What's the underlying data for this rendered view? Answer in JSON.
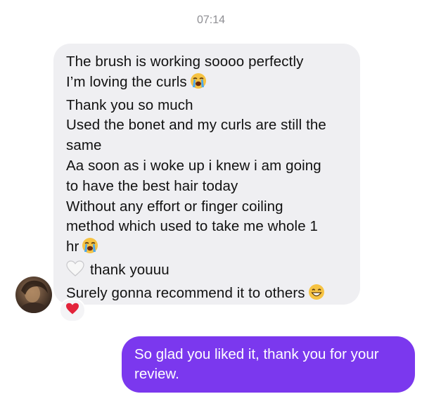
{
  "thread": {
    "timestamp": "07:14"
  },
  "incoming": {
    "lines": [
      "The brush is working soooo perfectly",
      "I’m loving the curls",
      "Thank you so much",
      "Used the bonet and my curls are still the",
      "same",
      "Aa soon as i woke up i knew i am going",
      "to have the best hair today",
      "Without any effort or finger coiling",
      "method which used to take me whole 1",
      "hr",
      "thank youuu",
      "Surely gonna recommend it to others"
    ],
    "emojis": {
      "line_2": "loudly-crying-face-emoji",
      "line_10": "loudly-crying-face-emoji",
      "line_11_lead": "white-heart-emoji",
      "line_12": "grinning-face-emoji"
    },
    "reaction": "red-heart-emoji"
  },
  "outgoing": {
    "lines": [
      "So glad you liked it, thank you for your",
      "review."
    ]
  },
  "colors": {
    "incoming_bubble": "#efeff2",
    "outgoing_bubble": "#7b38ee",
    "timestamp": "#8e8e93",
    "text": "#111111",
    "outgoing_text": "#ffffff"
  }
}
